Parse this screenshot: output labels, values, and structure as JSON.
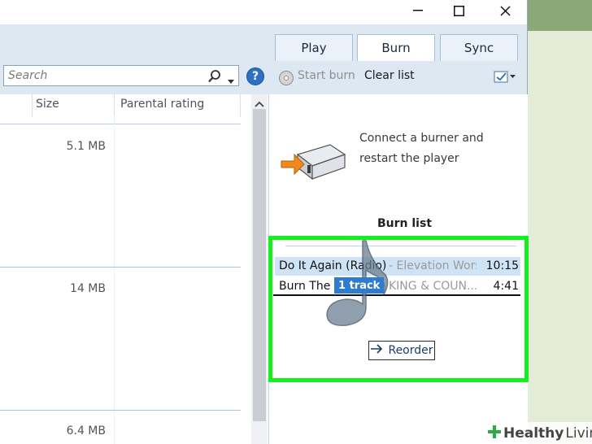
{
  "window": {
    "tabs": [
      {
        "label": "Play"
      },
      {
        "label": "Burn"
      },
      {
        "label": "Sync"
      }
    ]
  },
  "search": {
    "placeholder": "Search"
  },
  "burn_toolbar": {
    "start_burn": "Start burn",
    "clear_list": "Clear list"
  },
  "library": {
    "columns": [
      "Size",
      "Parental rating"
    ],
    "sizes": [
      "5.1 MB",
      "14 MB",
      "6.4 MB"
    ]
  },
  "burn_panel": {
    "message": "Connect a burner and restart the player",
    "list_title": "Burn list",
    "tracks": [
      {
        "title": "Do It Again (Radio)",
        "artist": "- Elevation Wors...",
        "length": "10:15"
      },
      {
        "title": "Burn The Sh",
        "artist": "KING & COUN...",
        "length": "4:41"
      }
    ],
    "drag_label": "1 track",
    "reorder_label": "Reorder"
  },
  "watermark": {
    "brand": "Healthy",
    "brand2": "Living"
  }
}
